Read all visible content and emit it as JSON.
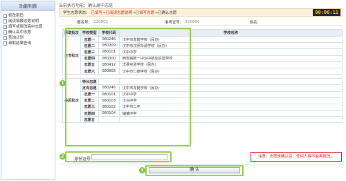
{
  "sidebar": {
    "title": "功能列表",
    "items": [
      {
        "label": "修改密码"
      },
      {
        "label": "阅读填报志愿说明"
      },
      {
        "label": "填写或修改高中志愿"
      },
      {
        "label": "确认高中志愿"
      },
      {
        "label": "查询计划"
      },
      {
        "label": "录取结果查询"
      }
    ]
  },
  "breadcrumb": "当前执行功能：确认高中志愿",
  "status": {
    "label": "学生志愿状态：",
    "steps": [
      "已填写",
      "→已阅读志愿说明",
      "→已填写志愿",
      "→已确认志愿"
    ],
    "timer": "00:06:11"
  },
  "info": {
    "regno_label": "报名号：",
    "regno_value": "220802",
    "examno_label": "准考证号：",
    "examno_value": "220806",
    "name_label": "姓名：",
    "name_value": ""
  },
  "table": {
    "headers": [
      "录取批次",
      "学校类型",
      "学校代码",
      "学校名称"
    ],
    "group1": {
      "batch": "全市批次",
      "rows": [
        {
          "type": "志愿一",
          "code": "080246",
          "name": "汉中市龙岗学校（民办）"
        },
        {
          "type": "志愿二",
          "code": "080209",
          "name": "汉中市汉阴华源学校（民办）"
        },
        {
          "type": "志愿三",
          "code": "080101",
          "name": "汉中中学"
        },
        {
          "type": "志愿四",
          "code": "080300",
          "name": "西安高新一中汉中航空实验学校"
        },
        {
          "type": "志愿五",
          "code": "080412",
          "name": "洋县实验学校（民办）"
        },
        {
          "type": "志愿六",
          "code": "080605",
          "name": "汉中市仁德学校（民办）"
        }
      ]
    },
    "group2": {
      "batch": "县区批次",
      "rows": [
        {
          "type": "特长志愿",
          "code": "",
          "name": ""
        },
        {
          "type": "定向志愿",
          "code": "080246",
          "name": "汉中市龙岗学校（民办）"
        },
        {
          "type": "志愿一",
          "code": "080101",
          "name": "汉中中学"
        },
        {
          "type": "志愿二",
          "code": "080103",
          "name": "汉台中学"
        },
        {
          "type": "志愿三",
          "code": "080102",
          "name": "汉中市二中"
        },
        {
          "type": "志愿四",
          "code": "080104",
          "name": "铺镇中学"
        },
        {
          "type": "志愿五",
          "code": "",
          "name": ""
        }
      ]
    }
  },
  "id_field": {
    "label": "身份证号：",
    "value": ""
  },
  "notice": "注意：志愿是确认后，任何人将不能再修改。",
  "confirm_label": "确  认",
  "badges": [
    "1",
    "2",
    "3"
  ],
  "colors": {
    "highlight": "#8fcf4a",
    "timer_text": "#ffd400",
    "warning": "#e02020"
  }
}
